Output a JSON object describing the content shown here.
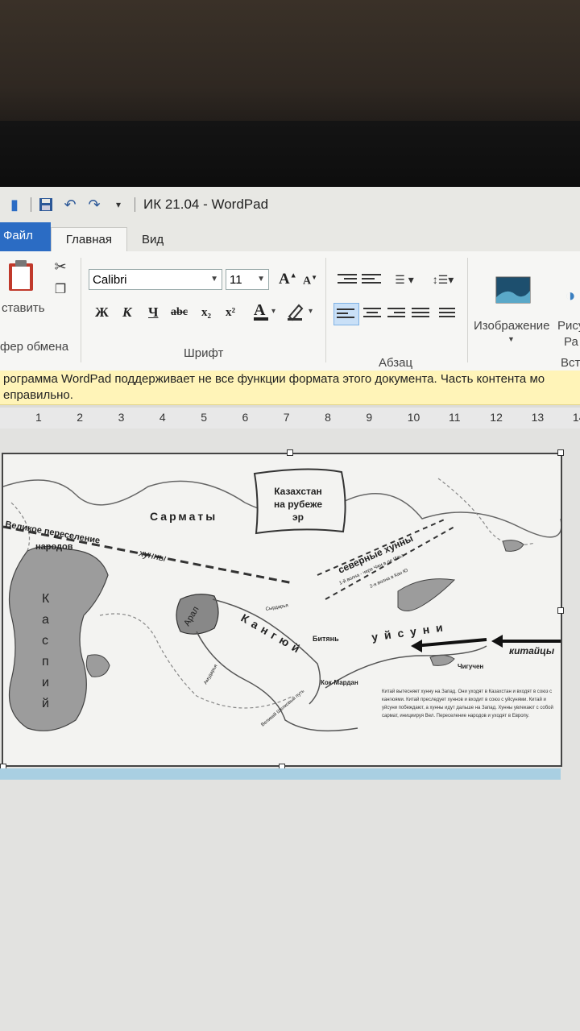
{
  "window": {
    "title": "ИК 21.04 - WordPad"
  },
  "tabs": {
    "file": "Файл",
    "home": "Главная",
    "view": "Вид"
  },
  "ribbon": {
    "paste_label": "ставить",
    "clipboard_group": "фер обмена",
    "font_group": "Шрифт",
    "paragraph_group": "Абзац",
    "insert_group": "Вста",
    "font_name": "Calibri",
    "font_size": "11",
    "bold": "Ж",
    "italic": "К",
    "underline": "Ч",
    "strikethrough": "abc",
    "subscript": "x₂",
    "superscript": "x²",
    "image_label": "Изображение",
    "drawing_label": "Рису",
    "drawing_label2": "Ра"
  },
  "infobar": {
    "line1": "рограмма WordPad поддерживает не все функции формата этого документа. Часть контента мо",
    "line2": "еправильно."
  },
  "ruler": {
    "marks": [
      "1",
      "2",
      "3",
      "4",
      "5",
      "6",
      "7",
      "8",
      "9",
      "10",
      "11",
      "12",
      "13",
      "14"
    ]
  },
  "map": {
    "title_line1": "Казахстан",
    "title_line2": "на рубеже",
    "title_line3": "эр",
    "sarmaty": "Сарматы",
    "great_migration_1": "Великое переселение",
    "great_migration_2": "народов",
    "huny": "хунны",
    "northern_huny": "северные хунны",
    "northern_route_1": "1-й волна - чере Чжи в ле Ильз",
    "northern_route_2": "2-я волна в Кан Ю",
    "aral": "Арал",
    "kangyu": "Кангюй",
    "usuni": "уйсуни",
    "china": "китайцы",
    "kaspiy": "Каспий",
    "bitjan": "Битянь",
    "kok_mardan": "Кок-Мардан",
    "chuguchen": "Чигучен",
    "syrdarya": "Сырдарья",
    "amudarya": "Амударья",
    "syr_note": "Великий Шелковый путь",
    "caption": "Китай вытесняет хунну на Запад. Они уходят в Казахстан и входят в союз с кангюями. Китай преследует хуннов и входит в союз с уйсунями. Китай и уйсуни побеждают, а хунны идут дальше на Запад. Хунны увлекают с собой сармат, инициируя Вел. Переселение народов и уходят в Европу."
  }
}
